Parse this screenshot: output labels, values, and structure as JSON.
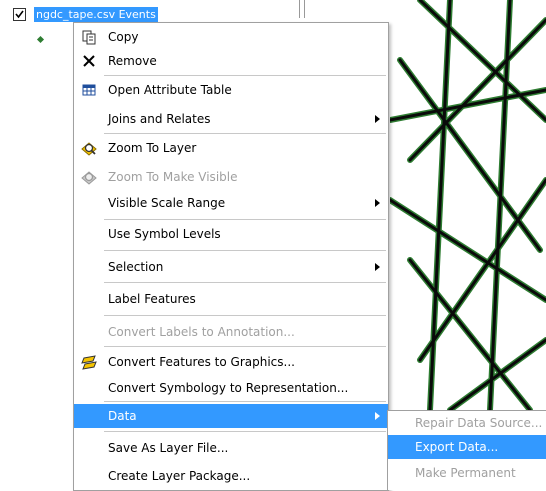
{
  "toc": {
    "layer_name": "ngdc_tape.csv Events",
    "checked": true,
    "symbol_color": "#2e7d32"
  },
  "menu": {
    "items": [
      {
        "label": "Copy",
        "icon": "copy-icon",
        "enabled": true
      },
      {
        "label": "Remove",
        "icon": "close-icon",
        "enabled": true
      },
      {
        "label": "Open Attribute Table",
        "icon": "table-icon",
        "enabled": true
      },
      {
        "label": "Joins and Relates",
        "enabled": true,
        "submenu": true
      },
      {
        "label": "Zoom To Layer",
        "icon": "zoom-to-layer-icon",
        "enabled": true
      },
      {
        "label": "Zoom To Make Visible",
        "icon": "zoom-to-visible-icon",
        "enabled": false
      },
      {
        "label": "Visible Scale Range",
        "enabled": true,
        "submenu": true
      },
      {
        "label": "Use Symbol Levels",
        "enabled": true
      },
      {
        "label": "Selection",
        "enabled": true,
        "submenu": true
      },
      {
        "label": "Label Features",
        "enabled": true
      },
      {
        "label": "Convert Labels to Annotation...",
        "enabled": false
      },
      {
        "label": "Convert Features to Graphics...",
        "icon": "convert-graphics-icon",
        "enabled": true
      },
      {
        "label": "Convert Symbology to Representation...",
        "enabled": true
      },
      {
        "label": "Data",
        "enabled": true,
        "submenu": true,
        "highlighted": true
      },
      {
        "label": "Save As Layer File...",
        "enabled": true
      },
      {
        "label": "Create Layer Package...",
        "enabled": true
      }
    ]
  },
  "data_submenu": {
    "items": [
      {
        "label": "Repair Data Source...",
        "enabled": false
      },
      {
        "label": "Export Data...",
        "enabled": true,
        "highlighted": true
      },
      {
        "label": "Make Permanent",
        "enabled": false
      }
    ]
  },
  "colors": {
    "highlight": "#3399ff",
    "disabled_text": "#a0a0a0",
    "map_track_dark": "#0a0a0a",
    "map_point_green": "#2e7d32"
  }
}
